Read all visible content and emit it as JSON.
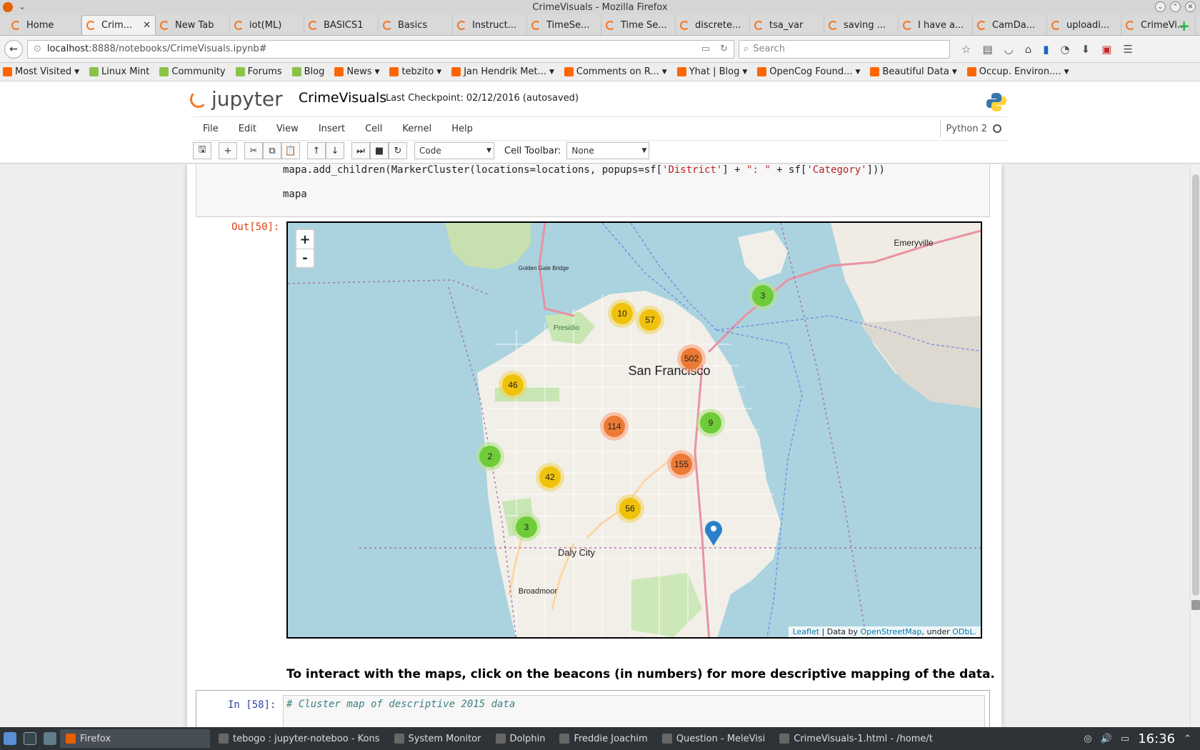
{
  "window": {
    "title": "CrimeVisuals - Mozilla Firefox"
  },
  "tabs": [
    {
      "label": "Home",
      "active": false
    },
    {
      "label": "Crim...",
      "active": true
    },
    {
      "label": "New Tab",
      "active": false
    },
    {
      "label": "iot(ML)",
      "active": false
    },
    {
      "label": "BASICS1",
      "active": false
    },
    {
      "label": "Basics",
      "active": false
    },
    {
      "label": "Instruct...",
      "active": false
    },
    {
      "label": "TimeSe...",
      "active": false
    },
    {
      "label": "Time Se...",
      "active": false
    },
    {
      "label": "discrete...",
      "active": false
    },
    {
      "label": "tsa_var",
      "active": false
    },
    {
      "label": "saving ...",
      "active": false
    },
    {
      "label": "I have a...",
      "active": false
    },
    {
      "label": "CamDa...",
      "active": false
    },
    {
      "label": "uploadi...",
      "active": false
    },
    {
      "label": "CrimeVisuals",
      "active": false
    }
  ],
  "nav": {
    "url_host": "localhost",
    "url_path": ":8888/notebooks/CrimeVisuals.ipynb#",
    "search_placeholder": "Search"
  },
  "bookmarks": [
    "Most Visited",
    "Linux Mint",
    "Community",
    "Forums",
    "Blog",
    "News",
    "tebzito",
    "Jan Hendrik Met...",
    "Comments on R...",
    "Yhat | Blog",
    "OpenCog Found...",
    "Beautiful Data",
    "Occup. Environ...."
  ],
  "jupyter": {
    "logo": "jupyter",
    "notebook_title": "CrimeVisuals",
    "checkpoint": "Last Checkpoint: 02/12/2016 (autosaved)",
    "kernel": "Python 2"
  },
  "menu": [
    "File",
    "Edit",
    "View",
    "Insert",
    "Cell",
    "Kernel",
    "Help"
  ],
  "toolbar": {
    "cell_type": "Code",
    "cell_toolbar_label": "Cell Toolbar:",
    "cell_toolbar_value": "None"
  },
  "cell_code": {
    "line1_a": "mapa.add_children(MarkerCluster(locations=locations, popups=sf[",
    "line1_s1": "'District'",
    "line1_b": "] + ",
    "line1_s2": "\": \"",
    "line1_c": " + sf[",
    "line1_s3": "'Category'",
    "line1_d": "]))",
    "line2": "mapa"
  },
  "output_prompt": "Out[50]:",
  "map": {
    "zoom_in": "+",
    "zoom_out": "-",
    "labels": [
      "San Francisco",
      "Daly City",
      "Emeryville",
      "Golden Gate Bridge",
      "Presidio",
      "Broadmoor"
    ],
    "clusters": [
      {
        "count": "10",
        "color": "yellow"
      },
      {
        "count": "57",
        "color": "yellow"
      },
      {
        "count": "502",
        "color": "orange"
      },
      {
        "count": "46",
        "color": "yellow"
      },
      {
        "count": "114",
        "color": "orange"
      },
      {
        "count": "9",
        "color": "green"
      },
      {
        "count": "2",
        "color": "green"
      },
      {
        "count": "42",
        "color": "yellow"
      },
      {
        "count": "155",
        "color": "orange"
      },
      {
        "count": "56",
        "color": "yellow"
      },
      {
        "count": "3",
        "color": "green"
      },
      {
        "count": "3",
        "color": "green"
      }
    ],
    "attribution": {
      "leaflet": "Leaflet",
      "sep1": " | Data by ",
      "osm": "OpenStreetMap",
      "sep2": ", under ",
      "odbl": "ODbL."
    }
  },
  "markdown": "To interact with the maps, click on the beacons (in numbers) for more descriptive mapping of the data.",
  "next_cell": {
    "prompt": "In [58]:",
    "comment": "# Cluster map of descriptive 2015 data"
  },
  "taskbar": {
    "items": [
      "Firefox",
      "tebogo : jupyter-noteboo - Kons",
      "System Monitor",
      "Dolphin",
      "Freddie Joachim",
      "Question - MeleVisi",
      "CrimeVisuals-1.html - /home/t"
    ],
    "clock": "16:36"
  }
}
